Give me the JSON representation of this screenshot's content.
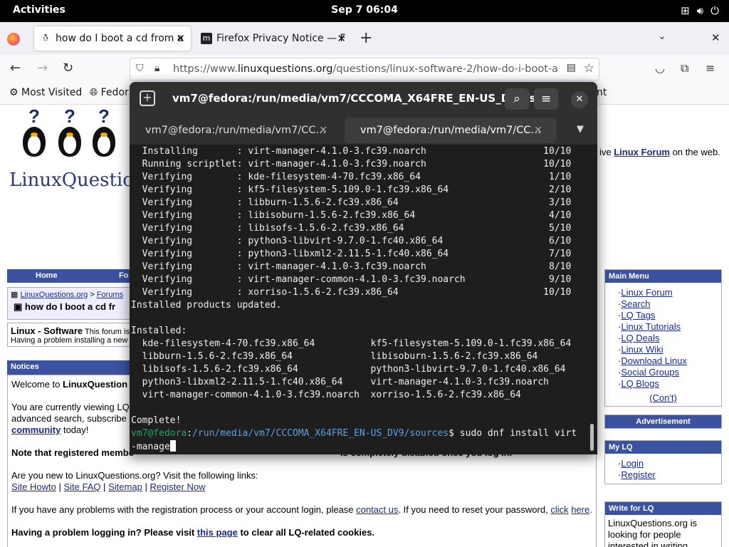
{
  "topbar": {
    "activities": "Activities",
    "clock": "Sep 7  06:04"
  },
  "browser": {
    "tabs": [
      {
        "title": "how do I boot a cd from a",
        "active": true
      },
      {
        "title": "Firefox Privacy Notice — F",
        "active": false
      }
    ],
    "url_prefix": "https://www.",
    "url_domain": "linuxquestions.org",
    "url_path": "/questions/linux-software-2/how-do-i-boot-a-",
    "bookmarks": {
      "most_visited": "Most Visited",
      "fedora": "Fedor",
      "partial_right": "nt"
    }
  },
  "page": {
    "logo_text": "LinuxQuestions",
    "tagline_prefix": "ive ",
    "tagline_link": "Linux Forum",
    "tagline_suffix": " on the web.",
    "nav": {
      "home": "Home",
      "fo": "Fo"
    },
    "breadcrumb": {
      "site": "LinuxQuestions.org",
      "sep": ">",
      "forums": "Forums",
      "thread": "how do I boot a cd fr"
    },
    "forum": {
      "name": "Linux - Software",
      "desc": "This forum is",
      "desc2": "Having a problem installing a new"
    },
    "notices": {
      "header": "Notices",
      "welcome_prefix": "Welcome to ",
      "welcome_bold": "LinuxQuestion",
      "viewing_1": "You are currently viewing LQ",
      "viewing_2": "advanced search, subscribe",
      "community": "community",
      "today": " today!",
      "note": "Note that registered membe",
      "note_tail": "ls completely disabled once you log in.",
      "newto": "Are you new to LinuxQuestions.org? Visit the following links:",
      "links": [
        "Site Howto",
        "Site FAQ",
        "Sitemap",
        "Register Now"
      ],
      "problems_1": "If you have any problems with the registration process or your account login, please ",
      "contact": "contact us",
      "problems_2": ". If you need to reset your password, ",
      "click": "click",
      "here": "here",
      "period": ".",
      "cookies_1": "Having a problem logging in? Please visit ",
      "this_page": "this page",
      "cookies_2": " to clear all LQ-related cookies."
    },
    "main_menu": {
      "header": "Main Menu",
      "items": [
        "Linux Forum",
        "Search",
        "LQ Tags",
        "Linux Tutorials",
        "LQ Deals",
        "Linux Wiki",
        "Download Linux",
        "Social Groups",
        "LQ Blogs"
      ],
      "cont": "(Con't)"
    },
    "advertisement": "Advertisement",
    "my_lq": {
      "header": "My LQ",
      "items": [
        "Login",
        "Register"
      ]
    },
    "write_for_lq": {
      "header": "Write for LQ",
      "text": "LinuxQuestions.org is looking for people interested in writing"
    }
  },
  "terminal": {
    "title": "vm7@fedora:/run/media/vm7/CCCOMA_X64FRE_EN-US_DV9/s…",
    "tabs": [
      {
        "title": "vm7@fedora:/run/media/vm7/CC…",
        "active": false
      },
      {
        "title": "vm7@fedora:/run/media/vm7/CC…",
        "active": true
      }
    ],
    "output": "  Installing       : virt-manager-4.1.0-3.fc39.noarch                     10/10\n  Running scriptlet: virt-manager-4.1.0-3.fc39.noarch                     10/10\n  Verifying        : kde-filesystem-4-70.fc39.x86_64                       1/10\n  Verifying        : kf5-filesystem-5.109.0-1.fc39.x86_64                  2/10\n  Verifying        : libburn-1.5.6-2.fc39.x86_64                           3/10\n  Verifying        : libisoburn-1.5.6-2.fc39.x86_64                        4/10\n  Verifying        : libisofs-1.5.6-2.fc39.x86_64                          5/10\n  Verifying        : python3-libvirt-9.7.0-1.fc40.x86_64                   6/10\n  Verifying        : python3-libxml2-2.11.5-1.fc40.x86_64                  7/10\n  Verifying        : virt-manager-4.1.0-3.fc39.noarch                      8/10\n  Verifying        : virt-manager-common-4.1.0-3.fc39.noarch               9/10\n  Verifying        : xorriso-1.5.6-2.fc39.x86_64                          10/10\nInstalled products updated.\n\nInstalled:\n  kde-filesystem-4-70.fc39.x86_64          kf5-filesystem-5.109.0-1.fc39.x86_64\n  libburn-1.5.6-2.fc39.x86_64              libisoburn-1.5.6-2.fc39.x86_64\n  libisofs-1.5.6-2.fc39.x86_64             python3-libvirt-9.7.0-1.fc40.x86_64\n  python3-libxml2-2.11.5-1.fc40.x86_64     virt-manager-4.1.0-3.fc39.noarch\n  virt-manager-common-4.1.0-3.fc39.noarch  xorriso-1.5.6-2.fc39.x86_64\n\nComplete!",
    "prompt_user": "vm7@fedora",
    "prompt_sep": ":",
    "prompt_path": "/run/media/vm7/CCCOMA_X64FRE_EN-US_DV9/sources",
    "prompt_cmd": "$ sudo dnf install virt",
    "prompt_wrap": "-manage"
  },
  "colors": {
    "terminal_bg": "#1e1e1e",
    "prompt_user": "#26a269",
    "prompt_path": "#5aa0e8",
    "lq_blue": "#3a52a0"
  }
}
